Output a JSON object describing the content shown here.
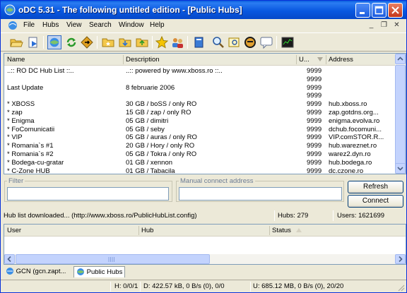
{
  "window": {
    "title": "oDC 5.31 - The following untitled edition - [Public Hubs]",
    "minimize_icon": "minimize-icon",
    "maximize_icon": "maximize-icon",
    "close_icon": "close-icon"
  },
  "menu": {
    "items": [
      "File",
      "Hubs",
      "View",
      "Search",
      "Window",
      "Help"
    ],
    "mdi_controls": [
      "_",
      "❐",
      "✕"
    ]
  },
  "toolbar": {
    "icons": [
      "open-folder-icon",
      "open-file-icon",
      "public-hubs-icon",
      "reconnect-icon",
      "follow-redirect-icon",
      "favorite-folder-icon",
      "download-folder-icon",
      "upload-folder-icon",
      "favorites-star-icon",
      "users-icon",
      "notepad-icon",
      "search-icon",
      "adl-search-icon",
      "spy-icon",
      "chat-icon",
      "network-stats-icon"
    ]
  },
  "hublist": {
    "columns": {
      "name": "Name",
      "description": "Description",
      "users": "U...",
      "address": "Address"
    },
    "rows": [
      {
        "name": "..:: RO DC Hub List ::..",
        "description": "..:: powered by www.xboss.ro ::..",
        "users": "9999",
        "address": ""
      },
      {
        "name": "",
        "description": "",
        "users": "9999",
        "address": ""
      },
      {
        "name": "Last Update",
        "description": "8 februarie 2006",
        "users": "9999",
        "address": ""
      },
      {
        "name": "",
        "description": "",
        "users": "9999",
        "address": ""
      },
      {
        "name": "* XBOSS",
        "description": "30 GB / boSS / only RO",
        "users": "9999",
        "address": "hub.xboss.ro"
      },
      {
        "name": "* zap",
        "description": "15 GB / zap / only RO",
        "users": "9999",
        "address": "zap.gotdns.org..."
      },
      {
        "name": "* Enigma",
        "description": "05 GB / dimitri",
        "users": "9999",
        "address": "enigma.evolva.ro"
      },
      {
        "name": "* FoComunicatii",
        "description": "05 GB / seby",
        "users": "9999",
        "address": "dchub.focomuni..."
      },
      {
        "name": "* VIP",
        "description": "05 GB / auras / only RO",
        "users": "9999",
        "address": "VIP.comSTOR.R..."
      },
      {
        "name": "* Romania`s #1",
        "description": "20 GB / Hory / only RO",
        "users": "9999",
        "address": "hub.wareznet.ro"
      },
      {
        "name": "* Romania`s #2",
        "description": "05 GB / Tokra / only RO",
        "users": "9999",
        "address": "warez2.dyn.ro"
      },
      {
        "name": "* Bodega-cu-gratar",
        "description": "01 GB / xennon",
        "users": "9999",
        "address": "hub.bodega.ro"
      },
      {
        "name": "* C-Zone HUB",
        "description": "01 GB / Tabacila",
        "users": "9999",
        "address": "dc.czone.ro"
      }
    ]
  },
  "filter": {
    "label": "Filter",
    "value": ""
  },
  "manual": {
    "label": "Manual connect address",
    "value": ""
  },
  "buttons": {
    "refresh": "Refresh",
    "connect": "Connect"
  },
  "status_hubs": {
    "message": "Hub list downloaded... (http://www.xboss.ro/PublicHubList.config)",
    "hubs": "Hubs: 279",
    "users": "Users: 1621699"
  },
  "userlist": {
    "columns": {
      "user": "User",
      "hub": "Hub",
      "status": "Status"
    }
  },
  "tabs": [
    {
      "label": "GCN (gcn.zapt...",
      "icon": "hub-icon"
    },
    {
      "label": "Public Hubs",
      "icon": "public-hubs-icon"
    }
  ],
  "status_bar": {
    "hubs": "H: 0/0/1",
    "download": "D: 422.57 kB, 0 B/s (0), 0/0",
    "upload": "U: 685.12 MB, 0 B/s (0), 20/20"
  }
}
